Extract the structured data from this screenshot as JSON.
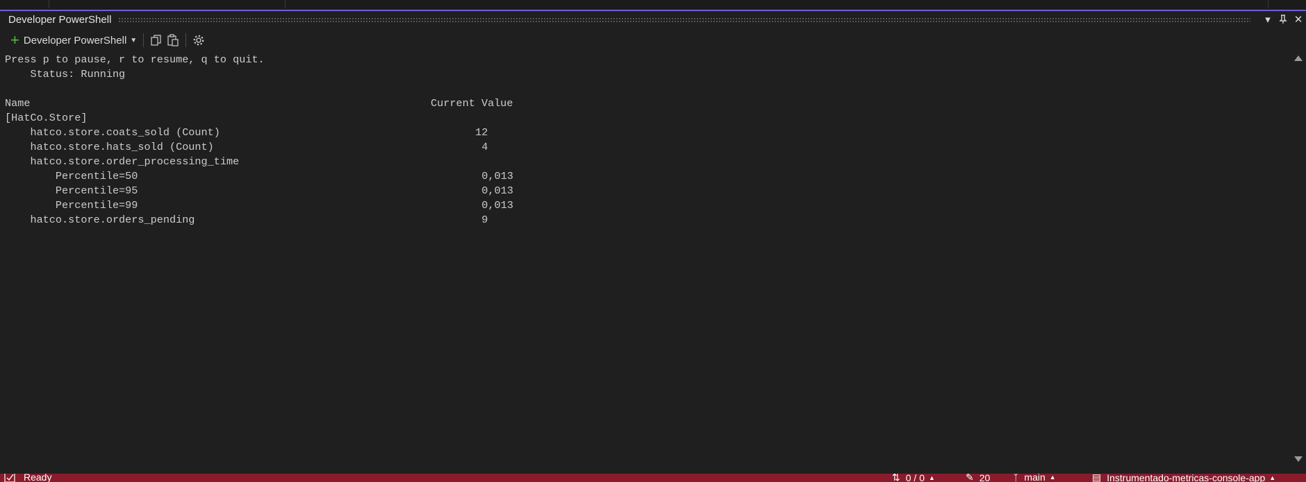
{
  "panel": {
    "title": "Developer PowerShell"
  },
  "toolbar": {
    "profile_label": "Developer PowerShell"
  },
  "terminal": {
    "lines": [
      {
        "text": "Press p to pause, r to resume, q to quit."
      },
      {
        "text": "    Status: Running"
      },
      {
        "text": ""
      },
      {
        "text": "Name",
        "value": "Current Value",
        "value_col": 67
      },
      {
        "text": "[HatCo.Store]"
      },
      {
        "text": "    hatco.store.coats_sold (Count)",
        "value": "12",
        "value_col": 74
      },
      {
        "text": "    hatco.store.hats_sold (Count)",
        "value": "4",
        "value_col": 75
      },
      {
        "text": "    hatco.store.order_processing_time"
      },
      {
        "text": "        Percentile=50",
        "value": "0,013",
        "value_col": 75
      },
      {
        "text": "        Percentile=95",
        "value": "0,013",
        "value_col": 75
      },
      {
        "text": "        Percentile=99",
        "value": "0,013",
        "value_col": 75
      },
      {
        "text": "    hatco.store.orders_pending",
        "value": "9",
        "value_col": 75
      }
    ]
  },
  "statusbar": {
    "state": "Ready",
    "changes": "0 / 0",
    "edits": "20",
    "branch": "main",
    "repo": "Instrumentado-metricas-console-app"
  },
  "colors": {
    "accent": "#6e5fd6",
    "status_bg": "#8a1b2b",
    "add_icon": "#59b54a"
  }
}
